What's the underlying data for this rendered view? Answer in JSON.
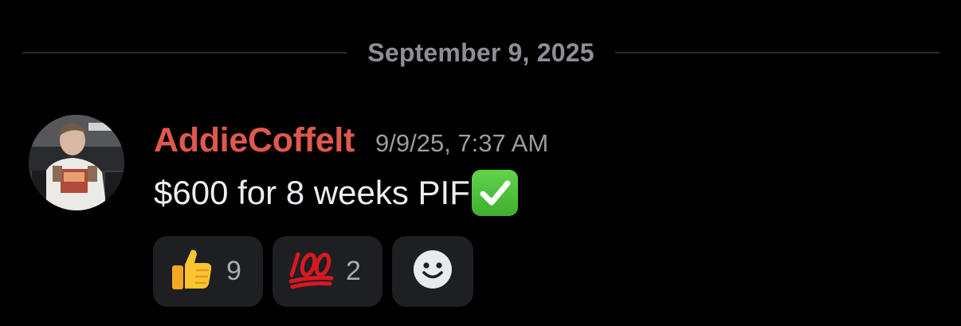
{
  "divider": {
    "date": "September 9, 2025"
  },
  "message": {
    "author": "AddieCoffelt",
    "author_color": "#e0584d",
    "timestamp": "9/9/25, 7:37 AM",
    "text": "$600 for 8 weeks PIF",
    "trailing_emoji": "white-check-mark-icon"
  },
  "reactions": [
    {
      "emoji": "thumbs-up-icon",
      "count": "9"
    },
    {
      "emoji": "hundred-points-icon",
      "count": "2"
    }
  ],
  "add_reaction": {
    "icon": "smiley-add-reaction-icon"
  },
  "colors": {
    "background": "#000000",
    "reaction_bg": "#1e1f23",
    "muted_text": "#8c8f96"
  }
}
